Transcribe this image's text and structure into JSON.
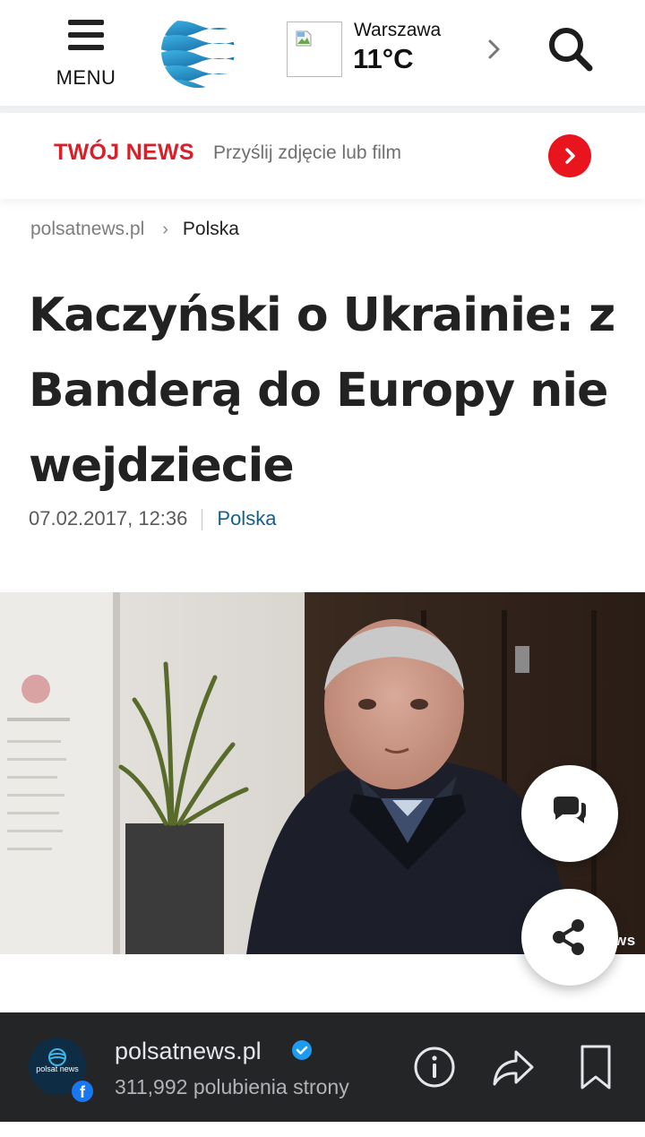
{
  "header": {
    "menu_label": "MENU",
    "weather": {
      "city": "Warszawa",
      "temperature": "11°C"
    }
  },
  "twoj_news": {
    "title": "TWÓJ NEWS",
    "text": "Przyślij zdjęcie lub film"
  },
  "breadcrumb": {
    "home": "polsatnews.pl",
    "separator": "›",
    "current": "Polska"
  },
  "article": {
    "title": "Kaczyński o Ukrainie: z Banderą do Europy nie wejdziecie",
    "date": "07.02.2017, 12:36",
    "category": "Polska",
    "photo_overlay": "ws"
  },
  "facebook_bar": {
    "avatar_text": "polsat news",
    "page_name": "polsatnews.pl",
    "likes": "311,992 polubienia strony",
    "badge_glyph": "f"
  },
  "colors": {
    "brand_red": "#e8141e",
    "category_blue": "#125f8c",
    "facebook_blue": "#1877f2",
    "bar_dark": "#242526"
  },
  "icons": [
    "menu-icon",
    "globe-logo-icon",
    "broken-image-icon",
    "chevron-right-icon",
    "search-icon",
    "chevron-right-icon",
    "comments-icon",
    "share-icon",
    "facebook-icon",
    "verified-icon",
    "info-icon",
    "forward-icon",
    "bookmark-icon"
  ]
}
